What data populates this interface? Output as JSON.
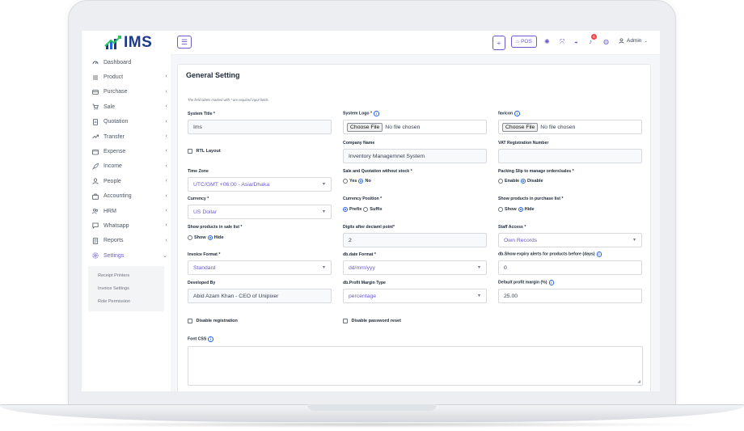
{
  "app": {
    "logo_text": "IMS"
  },
  "sidebar": {
    "items": [
      {
        "label": "Dashboard",
        "icon": "dashboard-icon"
      },
      {
        "label": "Product",
        "icon": "list-icon"
      },
      {
        "label": "Purchase",
        "icon": "card-icon"
      },
      {
        "label": "Sale",
        "icon": "cart-icon"
      },
      {
        "label": "Quotation",
        "icon": "document-icon"
      },
      {
        "label": "Transfer",
        "icon": "transfer-icon"
      },
      {
        "label": "Expense",
        "icon": "wallet-icon"
      },
      {
        "label": "Income",
        "icon": "rocket-icon"
      },
      {
        "label": "People",
        "icon": "user-icon"
      },
      {
        "label": "Accounting",
        "icon": "briefcase-icon"
      },
      {
        "label": "HRM",
        "icon": "users-icon"
      },
      {
        "label": "Whatsapp",
        "icon": "chat-icon"
      },
      {
        "label": "Reports",
        "icon": "report-icon"
      },
      {
        "label": "Settings",
        "icon": "gear-icon"
      }
    ],
    "settings_sub": [
      "Receipt Printers",
      "Invoice Settings",
      "Role Permission"
    ]
  },
  "topbar": {
    "plus": "+",
    "pos_label": "POS",
    "badge_count": "6",
    "admin_label": "Admin"
  },
  "page": {
    "title": "General Setting",
    "note": "The field labels marked with * are required input fields."
  },
  "form": {
    "system_title": {
      "label": "System Title *",
      "value": "Ims"
    },
    "system_logo": {
      "label": "System Logo *",
      "button": "Choose File",
      "status": "No file chosen"
    },
    "favicon": {
      "label": "favicon",
      "button": "Choose File",
      "status": "No file chosen"
    },
    "rtl_layout": {
      "label": "RTL Layout"
    },
    "company_name": {
      "label": "Company Name",
      "value": "Inventory Managemnet System"
    },
    "vat_registration": {
      "label": "VAT Registration Number",
      "value": ""
    },
    "time_zone": {
      "label": "Time Zone",
      "value": "UTC/GMT +06:00 - Asia/Dhaka"
    },
    "sale_quotation_stock": {
      "label": "Sale and Quotation without stock *",
      "opt1": "Yes",
      "opt2": "No"
    },
    "packing_slip": {
      "label": "Packing Slip to manage orders/sales *",
      "opt1": "Enable",
      "opt2": "Disable"
    },
    "currency": {
      "label": "Currency *",
      "value": "US Dollar"
    },
    "currency_position": {
      "label": "Currency Position *",
      "opt1": "Prefix",
      "opt2": "Suffix"
    },
    "purchase_list": {
      "label": "Show products in purchase list *",
      "opt1": "Show",
      "opt2": "Hide"
    },
    "sale_list": {
      "label": "Show products in sale list *",
      "opt1": "Show",
      "opt2": "Hide"
    },
    "digits": {
      "label": "Digits after deciaml point*",
      "value": "2"
    },
    "staff_access": {
      "label": "Staff Access *",
      "value": "Own Records"
    },
    "invoice_format": {
      "label": "Invoice Format *",
      "value": "Standard"
    },
    "date_format": {
      "label": "db.date Format *",
      "value": "dd/mm/yyy"
    },
    "expiry_alerts": {
      "label": "db.Show expiry alerts for products before (days)",
      "value": "0"
    },
    "developed_by": {
      "label": "Developed By",
      "value": "Abid Azam Khan - CEO of Unipixer"
    },
    "profit_margin_type": {
      "label": "db.Profit Margin Type",
      "value": "percentage"
    },
    "default_profit_margin": {
      "label": "Default profit margin (%)",
      "value": "25.00"
    },
    "disable_registration": {
      "label": "Disable registration"
    },
    "disable_password_reset": {
      "label": "Disable password reset"
    },
    "font_css": {
      "label": "Font CSS"
    }
  },
  "colors": {
    "accent": "#6a5acd",
    "brand": "#1e3a8a",
    "info": "#2563eb"
  }
}
